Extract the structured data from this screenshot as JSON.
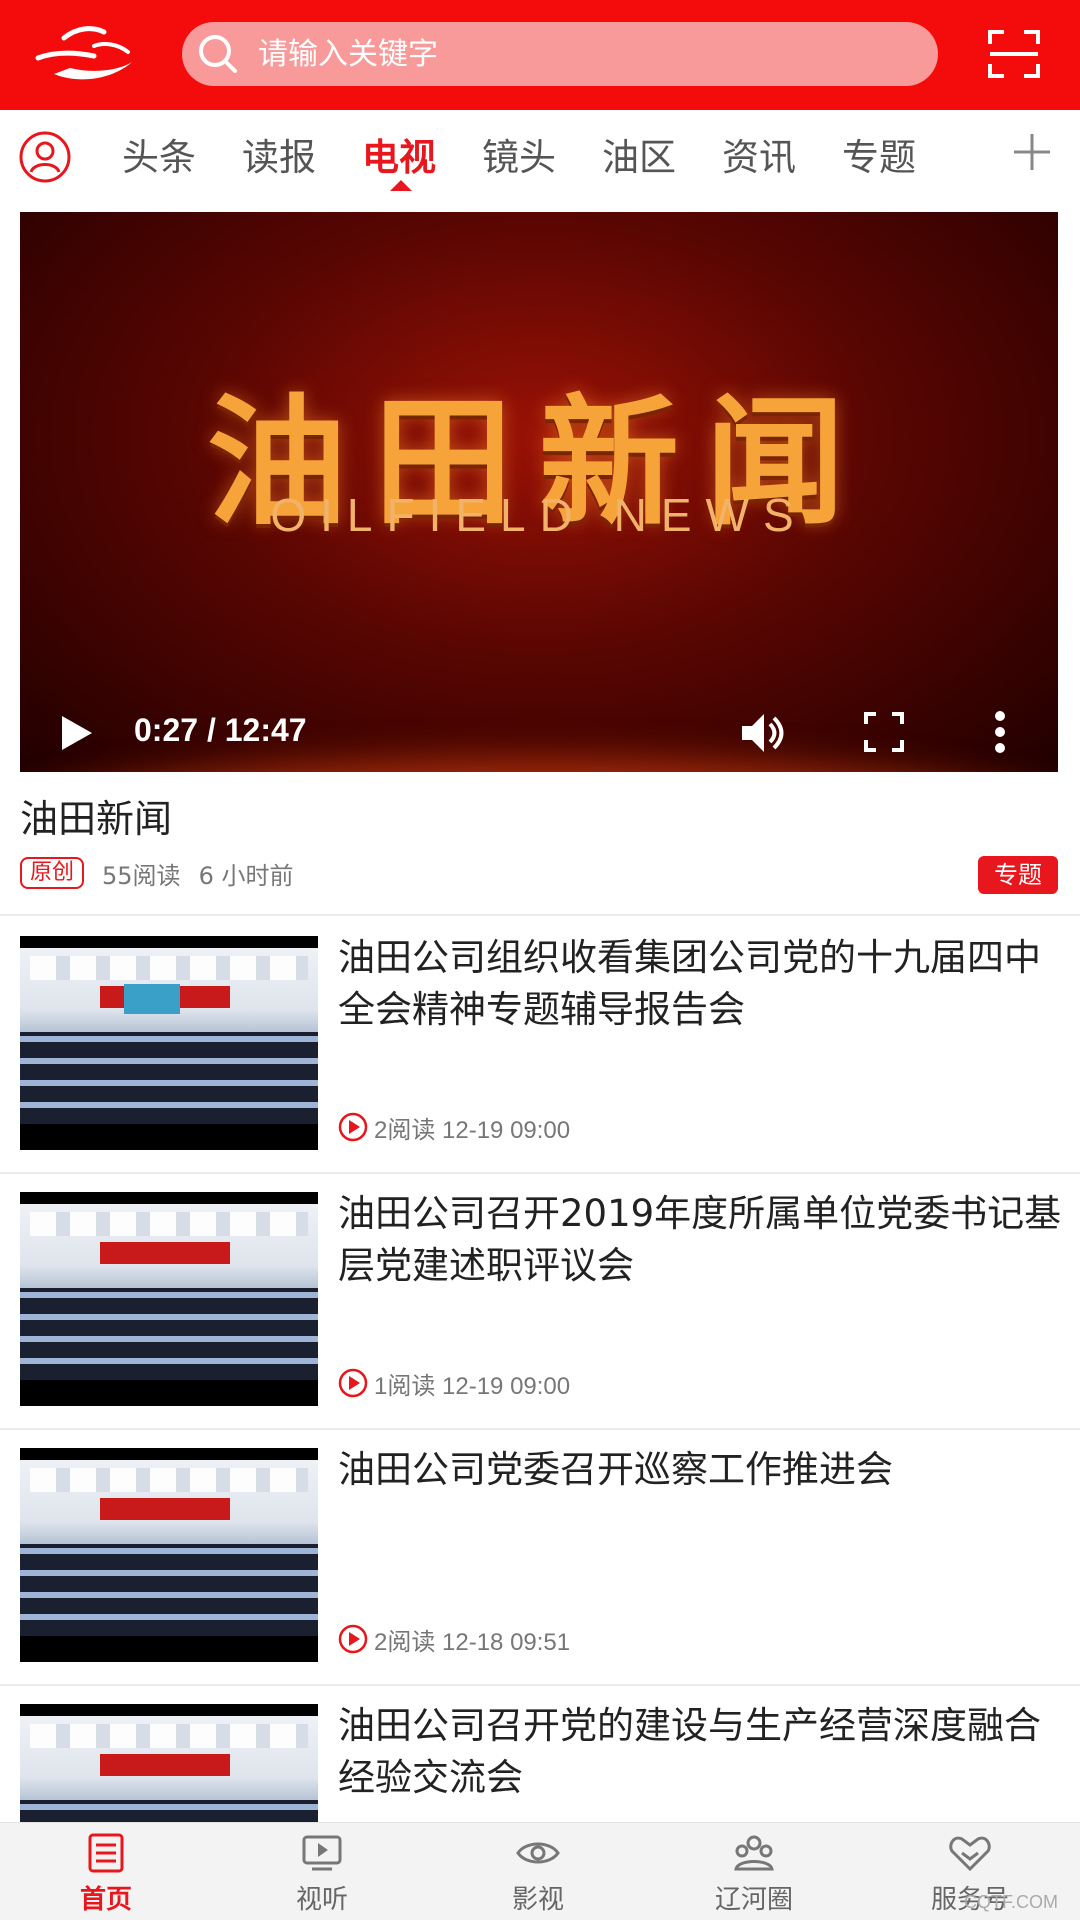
{
  "header": {
    "search_placeholder": "请输入关键字",
    "brand_color": "#f40b0b"
  },
  "tabs": [
    {
      "label": "头条",
      "active": false
    },
    {
      "label": "读报",
      "active": false
    },
    {
      "label": "电视",
      "active": true
    },
    {
      "label": "镜头",
      "active": false
    },
    {
      "label": "油区",
      "active": false
    },
    {
      "label": "资讯",
      "active": false
    },
    {
      "label": "专题",
      "active": false
    }
  ],
  "video": {
    "title_cn": "油田新闻",
    "title_en": "OILFIELD NEWS",
    "time": "0:27 / 12:47",
    "caption": "油田新闻",
    "badge_original": "原创",
    "reads": "55阅读",
    "age": "6 小时前",
    "badge_topic": "专题"
  },
  "news": [
    {
      "title": "油田公司组织收看集团公司党的十九届四中全会精神专题辅导报告会",
      "meta": "2阅读 12-19 09:00"
    },
    {
      "title": "油田公司召开2019年度所属单位党委书记基层党建述职评议会",
      "meta": "1阅读 12-19 09:00"
    },
    {
      "title": "油田公司党委召开巡察工作推进会",
      "meta": "2阅读 12-18 09:51"
    },
    {
      "title": "油田公司召开党的建设与生产经营深度融合经验交流会",
      "meta": ""
    }
  ],
  "bottom_nav": [
    {
      "label": "首页",
      "icon": "home-icon",
      "active": true
    },
    {
      "label": "视听",
      "icon": "video-icon",
      "active": false
    },
    {
      "label": "影视",
      "icon": "eye-icon",
      "active": false
    },
    {
      "label": "辽河圈",
      "icon": "community-icon",
      "active": false
    },
    {
      "label": "服务号",
      "icon": "handshake-icon",
      "active": false
    }
  ],
  "watermark": "CQTF.COM",
  "colors": {
    "accent": "#e8161d"
  }
}
